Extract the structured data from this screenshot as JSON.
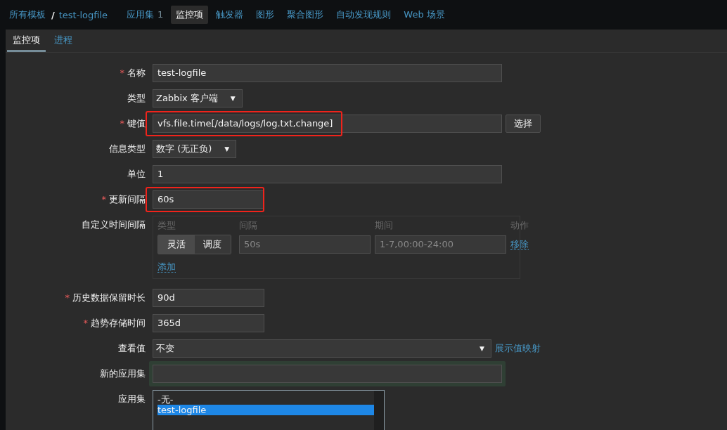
{
  "breadcrumb": [
    {
      "label": "所有模板"
    },
    {
      "label": "/"
    },
    {
      "label": "test-logfile"
    }
  ],
  "nav": [
    {
      "label": "应用集",
      "count": "1",
      "selected": false
    },
    {
      "label": "监控项",
      "selected": true
    },
    {
      "label": "触发器",
      "selected": false
    },
    {
      "label": "图形",
      "selected": false
    },
    {
      "label": "聚合图形",
      "selected": false
    },
    {
      "label": "自动发现规则",
      "selected": false
    },
    {
      "label": "Web 场景",
      "selected": false
    }
  ],
  "subtabs": [
    {
      "label": "监控项",
      "selected": true
    },
    {
      "label": "进程",
      "selected": false
    }
  ],
  "form": [
    {
      "kind": "text",
      "label": "名称",
      "required_mark": "*",
      "value": "test-logfile"
    },
    {
      "kind": "select",
      "label": "类型",
      "value": "Zabbix 客户端",
      "caret": "▼"
    },
    {
      "kind": "text",
      "label": "键值",
      "required_mark": "*",
      "value": "vfs.file.time[/data/logs/log.txt,change]",
      "button": "选择",
      "highlighted": true
    },
    {
      "kind": "select",
      "label": "信息类型",
      "value": "数字 (无正负)",
      "caret": "▼"
    },
    {
      "kind": "text",
      "label": "单位",
      "value": "1"
    },
    {
      "kind": "short_text",
      "label": "更新间隔",
      "required_mark": "*",
      "value": "60s",
      "highlighted": true
    },
    {
      "kind": "intervals",
      "label": "自定义时间间隔",
      "columns": [
        "类型",
        "间隔",
        "期间",
        "动作"
      ],
      "rows": [
        {
          "modes": [
            {
              "label": "灵活",
              "selected": true
            },
            {
              "label": "调度",
              "selected": false
            }
          ],
          "interval": "50s",
          "period": "1-7,00:00-24:00",
          "action": "移除"
        }
      ],
      "add": "添加"
    },
    {
      "kind": "short_text",
      "label": "历史数据保留时长",
      "required_mark": "*",
      "value": "90d"
    },
    {
      "kind": "short_text",
      "label": "趋势存储时间",
      "required_mark": "*",
      "value": "365d"
    },
    {
      "kind": "select",
      "label": "查看值",
      "value": "不变",
      "caret": "▼",
      "link": "展示值映射"
    },
    {
      "kind": "text",
      "label": "新的应用集",
      "focused": true
    },
    {
      "kind": "listbox",
      "label": "应用集",
      "options": [
        {
          "label": "-无-",
          "selected": false
        },
        {
          "label": "test-logfile",
          "selected": true
        }
      ]
    }
  ]
}
